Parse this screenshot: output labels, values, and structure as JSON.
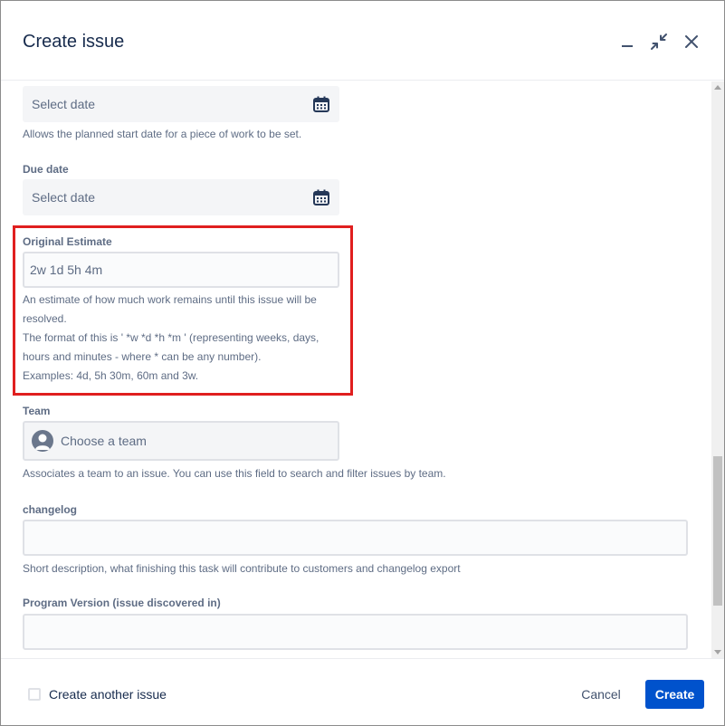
{
  "dialog": {
    "title": "Create issue",
    "icons": {
      "minimize": "minimize-icon",
      "collapse": "collapse-icon",
      "close": "close-icon"
    }
  },
  "fields": {
    "start_date": {
      "placeholder": "Select date",
      "help": "Allows the planned start date for a piece of work to be set."
    },
    "due_date": {
      "label": "Due date",
      "placeholder": "Select date"
    },
    "original_estimate": {
      "label": "Original Estimate",
      "value": "2w 1d 5h 4m",
      "help_lines": [
        "An estimate of how much work remains until this issue will be",
        "resolved.",
        "The format of this is ' *w *d *h *m ' (representing weeks, days,",
        "hours and minutes - where * can be any number).",
        "Examples: 4d, 5h 30m, 60m and 3w."
      ]
    },
    "team": {
      "label": "Team",
      "placeholder": "Choose a team",
      "help": "Associates a team to an issue. You can use this field to search and filter issues by team."
    },
    "changelog": {
      "label": "changelog",
      "value": "",
      "help": "Short description, what finishing this task will contribute to customers and changelog export"
    },
    "program_version": {
      "label": "Program Version (issue discovered in)",
      "value": ""
    }
  },
  "footer": {
    "create_another_label": "Create another issue",
    "create_another_checked": false,
    "cancel_label": "Cancel",
    "create_label": "Create"
  },
  "colors": {
    "primary": "#0052cc",
    "highlight_border": "#e01f1f",
    "label": "#5e6c84",
    "text": "#172b4d"
  }
}
